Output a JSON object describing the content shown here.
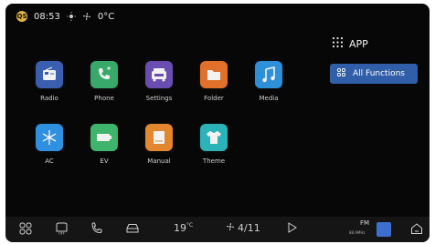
{
  "status": {
    "time_badge": "QS",
    "time": "08:53",
    "temperature": "0°C",
    "icons": [
      "clock-badge-icon",
      "brightness-icon",
      "fan-icon"
    ]
  },
  "apps": [
    {
      "label": "Radio",
      "icon": "radio-icon",
      "color": "#3a5fb0"
    },
    {
      "label": "Phone",
      "icon": "phone-icon",
      "color": "#38a86b"
    },
    {
      "label": "Settings",
      "icon": "settings-icon",
      "color": "#6a4db0"
    },
    {
      "label": "Folder",
      "icon": "folder-icon",
      "color": "#e0702a"
    },
    {
      "label": "Media",
      "icon": "music-icon",
      "color": "#2e90d8"
    },
    {
      "label": "AC",
      "icon": "snowflake-icon",
      "color": "#2f8fe0"
    },
    {
      "label": "EV",
      "icon": "battery-icon",
      "color": "#3fb46c"
    },
    {
      "label": "Manual",
      "icon": "book-icon",
      "color": "#e2862f"
    },
    {
      "label": "Theme",
      "icon": "shirt-icon",
      "color": "#2bb3b8"
    }
  ],
  "panel": {
    "heading": "APP",
    "all_functions": "All Functions"
  },
  "dock": {
    "temperature": "19",
    "temperature_unit": "°C",
    "fan_speed": "4/11",
    "fm_label": "FM",
    "fm_sub": "88.9MHz"
  },
  "colors": {
    "accent": "#315ea8",
    "background": "#070707",
    "dock": "#151515"
  }
}
